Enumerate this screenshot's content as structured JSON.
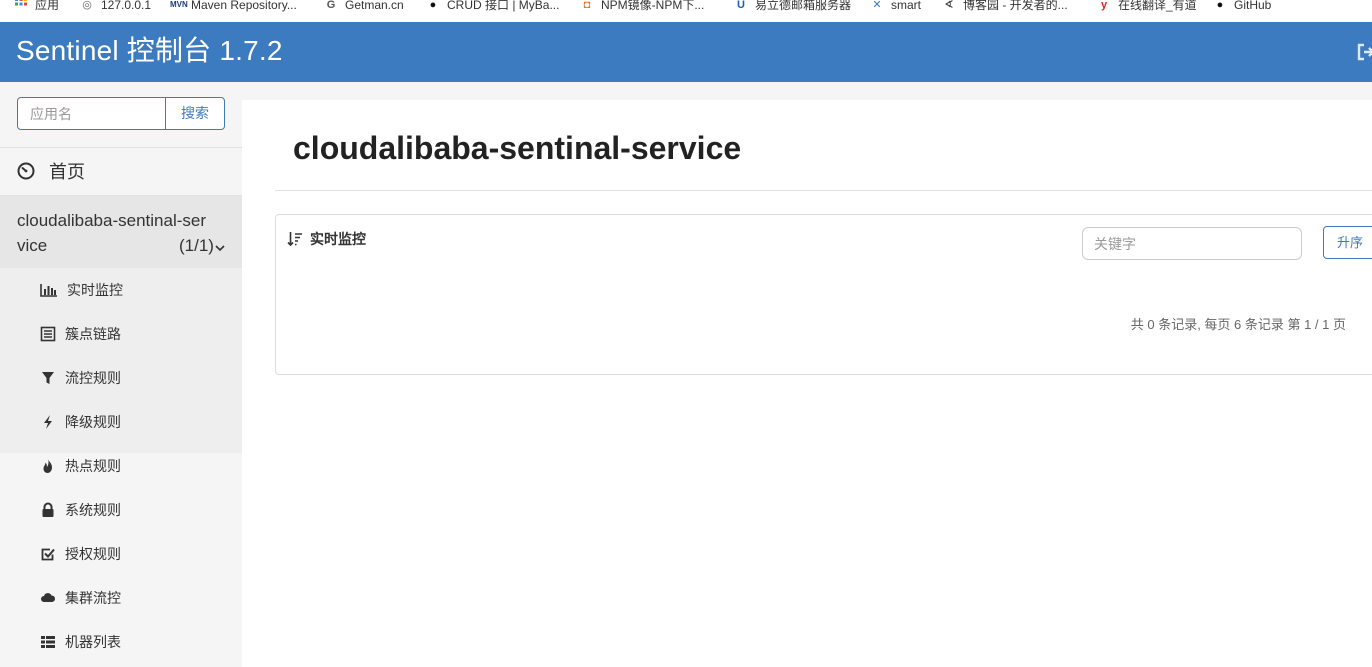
{
  "bookmarks": [
    {
      "icon": "apps-grid-icon",
      "label": "应用"
    },
    {
      "icon": "globe-icon",
      "label": "127.0.0.1"
    },
    {
      "icon": "maven-icon",
      "label": "Maven Repository..."
    },
    {
      "icon": "g-letter-icon",
      "label": "Getman.cn"
    },
    {
      "icon": "bird-icon",
      "label": "CRUD 接口 | MyBa..."
    },
    {
      "icon": "npm-icon",
      "label": "NPM镜像-NPM下..."
    },
    {
      "icon": "mail-icon",
      "label": "易立德邮箱服务器"
    },
    {
      "icon": "x-icon",
      "label": "smart"
    },
    {
      "icon": "cnblogs-icon",
      "label": "博客园 - 开发者的..."
    },
    {
      "icon": "youdao-icon",
      "label": "在线翻译_有道"
    },
    {
      "icon": "github-icon",
      "label": "GitHub"
    }
  ],
  "header": {
    "title": "Sentinel 控制台 1.7.2",
    "logout_icon": "sign-out-icon",
    "bg_color": "#3c7bbf"
  },
  "sidebar": {
    "search_placeholder": "应用名",
    "search_button": "搜索",
    "home_label": "首页",
    "app": {
      "name": "cloudalibaba-sentinal-service",
      "count": "(1/1)"
    },
    "items": [
      {
        "icon": "bar-chart-icon",
        "label": "实时监控"
      },
      {
        "icon": "list-icon",
        "label": "簇点链路"
      },
      {
        "icon": "filter-icon",
        "label": "流控规则"
      },
      {
        "icon": "bolt-icon",
        "label": "降级规则"
      },
      {
        "icon": "fire-icon",
        "label": "热点规则"
      },
      {
        "icon": "lock-icon",
        "label": "系统规则"
      },
      {
        "icon": "check-square-icon",
        "label": "授权规则"
      },
      {
        "icon": "cloud-icon",
        "label": "集群流控"
      },
      {
        "icon": "th-list-icon",
        "label": "机器列表"
      }
    ]
  },
  "main": {
    "page_title": "cloudalibaba-sentinal-service",
    "panel": {
      "title": "实时监控",
      "keyword_placeholder": "关键字",
      "sort_button": "升序",
      "pager_text": "共 0 条记录, 每页 6 条记录 第 1 / 1 页"
    }
  }
}
